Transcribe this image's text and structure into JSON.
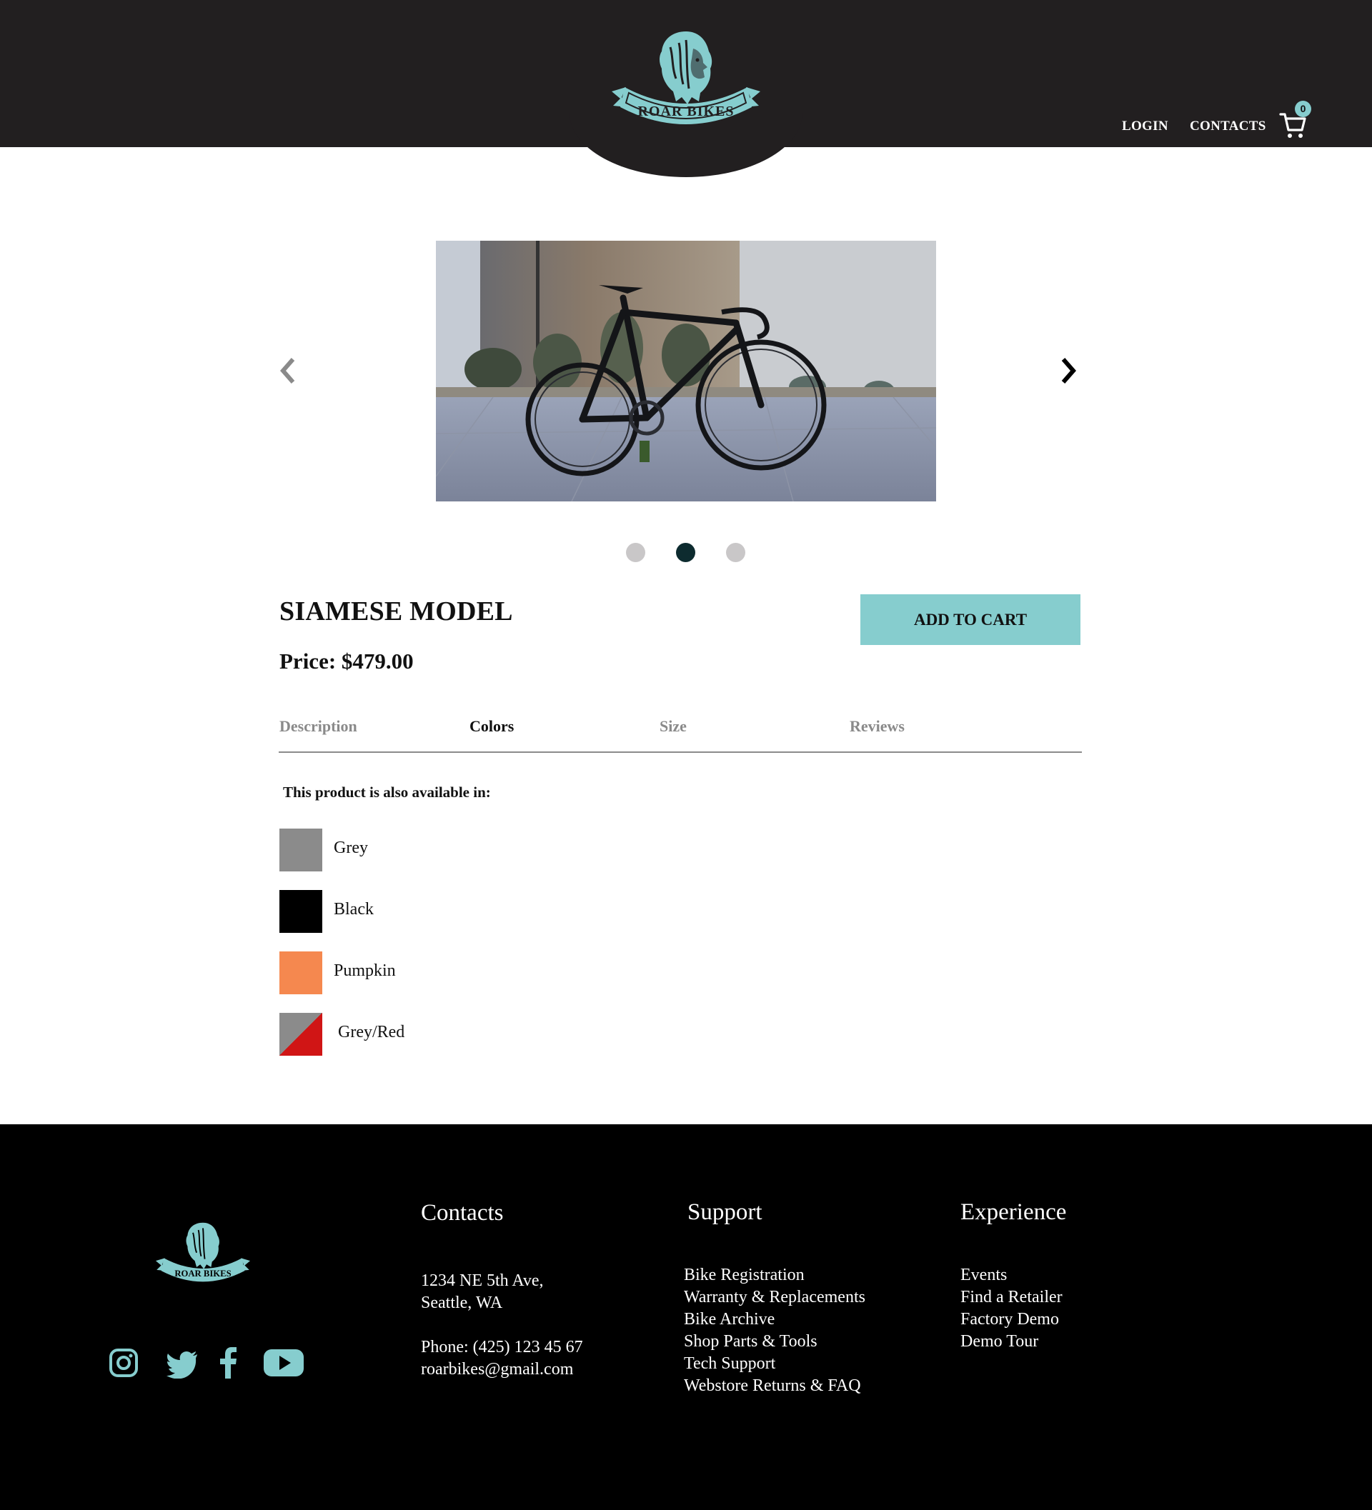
{
  "header": {
    "brand": "ROAR BIKES",
    "nav": {
      "login": "LOGIN",
      "contacts": "CONTACTS"
    },
    "cart": {
      "icon": "cart-icon",
      "count": "0"
    }
  },
  "carousel": {
    "prev_icon": "chevron-left-icon",
    "next_icon": "chevron-right-icon",
    "slide_count": 3,
    "active_index": 1
  },
  "product": {
    "title": "SIAMESE MODEL",
    "price": "Price: $479.00",
    "add_to_cart_label": "ADD TO CART"
  },
  "tabs": [
    {
      "label": "Description",
      "active": false
    },
    {
      "label": "Colors",
      "active": true
    },
    {
      "label": "Size",
      "active": false
    },
    {
      "label": "Reviews",
      "active": false
    }
  ],
  "colors": {
    "heading": "This product is also available in:",
    "options": [
      {
        "label": "Grey",
        "color": "#8b8b8b"
      },
      {
        "label": "Black",
        "color": "#000000"
      },
      {
        "label": "Pumpkin",
        "color": "#f5884f"
      },
      {
        "label": "Grey/Red",
        "color": "#8b8b8b",
        "color2": "#d01515"
      }
    ]
  },
  "footer": {
    "social": [
      "instagram-icon",
      "twitter-icon",
      "facebook-icon",
      "youtube-icon"
    ],
    "contacts": {
      "heading": "Contacts",
      "address_line1": "1234 NE 5th Ave,",
      "address_line2": "Seattle, WA",
      "phone": "Phone: (425) 123 45 67",
      "email": "roarbikes@gmail.com"
    },
    "support": {
      "heading": "Support",
      "links": [
        "Bike Registration",
        "Warranty & Replacements",
        "Bike Archive",
        "Shop Parts & Tools",
        "Tech Support",
        "Webstore Returns & FAQ"
      ]
    },
    "experience": {
      "heading": "Experience",
      "links": [
        "Events",
        "Find a Retailer",
        "Factory Demo",
        "Demo Tour"
      ]
    }
  },
  "colors_theme": {
    "accent": "#86cdce",
    "header_bg": "#221f20",
    "footer_bg": "#000000"
  }
}
